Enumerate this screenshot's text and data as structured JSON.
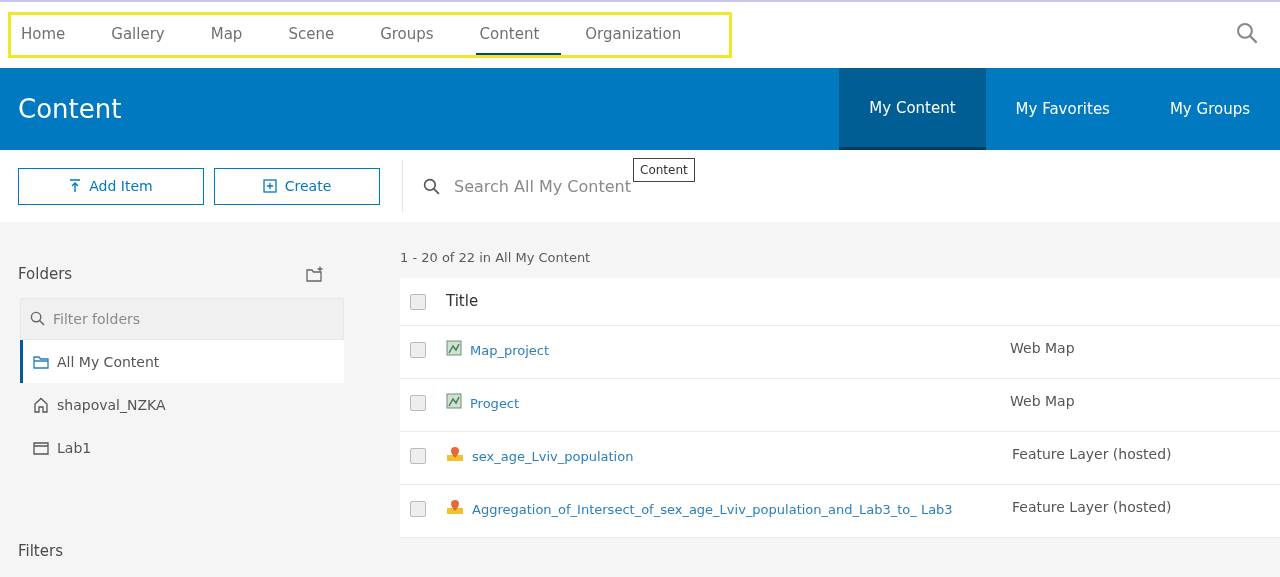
{
  "top_nav": {
    "tabs": [
      {
        "label": "Home",
        "selected": false
      },
      {
        "label": "Gallery",
        "selected": false
      },
      {
        "label": "Map",
        "selected": false
      },
      {
        "label": "Scene",
        "selected": false
      },
      {
        "label": "Groups",
        "selected": false
      },
      {
        "label": "Content",
        "selected": true
      },
      {
        "label": "Organization",
        "selected": false
      }
    ],
    "highlighted": true
  },
  "banner": {
    "title": "Content",
    "tabs": [
      {
        "label": "My Content",
        "selected": true
      },
      {
        "label": "My Favorites",
        "selected": false
      },
      {
        "label": "My Groups",
        "selected": false
      }
    ]
  },
  "toolbar": {
    "buttons": [
      {
        "label": "Add Item",
        "kind": "add"
      },
      {
        "label": "Create",
        "kind": "create"
      }
    ],
    "search": {
      "placeholder": "Search All My Content"
    },
    "tooltip": "Content"
  },
  "sidebar": {
    "folders_title": "Folders",
    "filter": {
      "placeholder": "Filter folders"
    },
    "folders": [
      {
        "label": "All My Content",
        "kind": "all",
        "selected": true
      },
      {
        "label": "shapoval_NZKA",
        "kind": "home",
        "selected": false
      },
      {
        "label": "Lab1",
        "kind": "folder",
        "selected": false
      }
    ],
    "filters_title": "Filters"
  },
  "list": {
    "summary": "1 - 20 of 22 in All My Content",
    "header": {
      "title": "Title",
      "checked": false
    },
    "rows": [
      {
        "title": "Map_project",
        "type": "Web Map",
        "kind": "map",
        "checked": false
      },
      {
        "title": "Progect",
        "type": "Web Map",
        "kind": "map",
        "checked": false
      },
      {
        "title": "sex_age_Lviv_population",
        "type": "Feature Layer (hosted)",
        "kind": "layer",
        "checked": false
      },
      {
        "title": "Aggregation_of_Intersect_of_sex_age_Lviv_population_and_Lab3_to_ Lab3",
        "type": "Feature Layer (hosted)",
        "kind": "layer",
        "checked": false
      }
    ]
  }
}
